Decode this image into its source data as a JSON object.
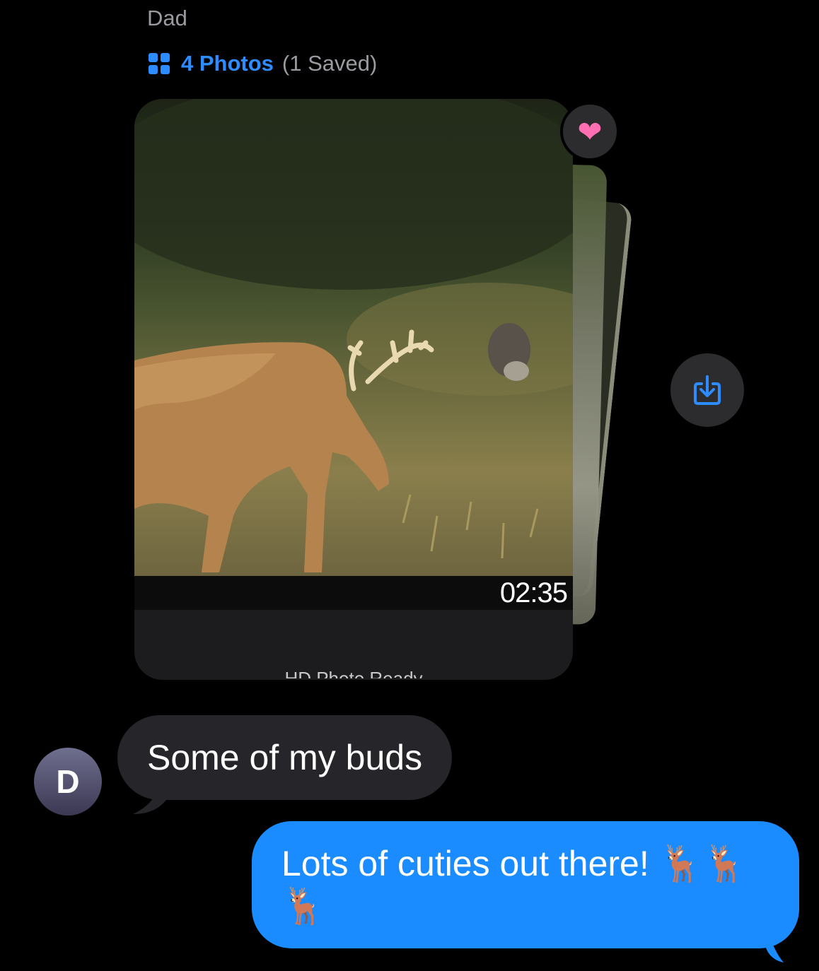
{
  "conversation": {
    "sender_name": "Dad",
    "photos_header": {
      "count_label": "4 Photos",
      "saved_label": "(1 Saved)"
    },
    "photo": {
      "timestamp": "02:35",
      "status_label": "HD Photo Ready",
      "tapback": "❤"
    },
    "avatar_initial": "D",
    "incoming_message": "Some of my buds",
    "outgoing_message": "Lots of cuties out there! 🦌🦌🦌"
  },
  "colors": {
    "background": "#000000",
    "incoming_bubble": "#26252a",
    "outgoing_bubble": "#1a8cff",
    "accent": "#2d8cff",
    "secondary_text": "#9a9aa0"
  },
  "icons": [
    "photo-grid-icon",
    "heart-icon",
    "save-download-icon"
  ]
}
